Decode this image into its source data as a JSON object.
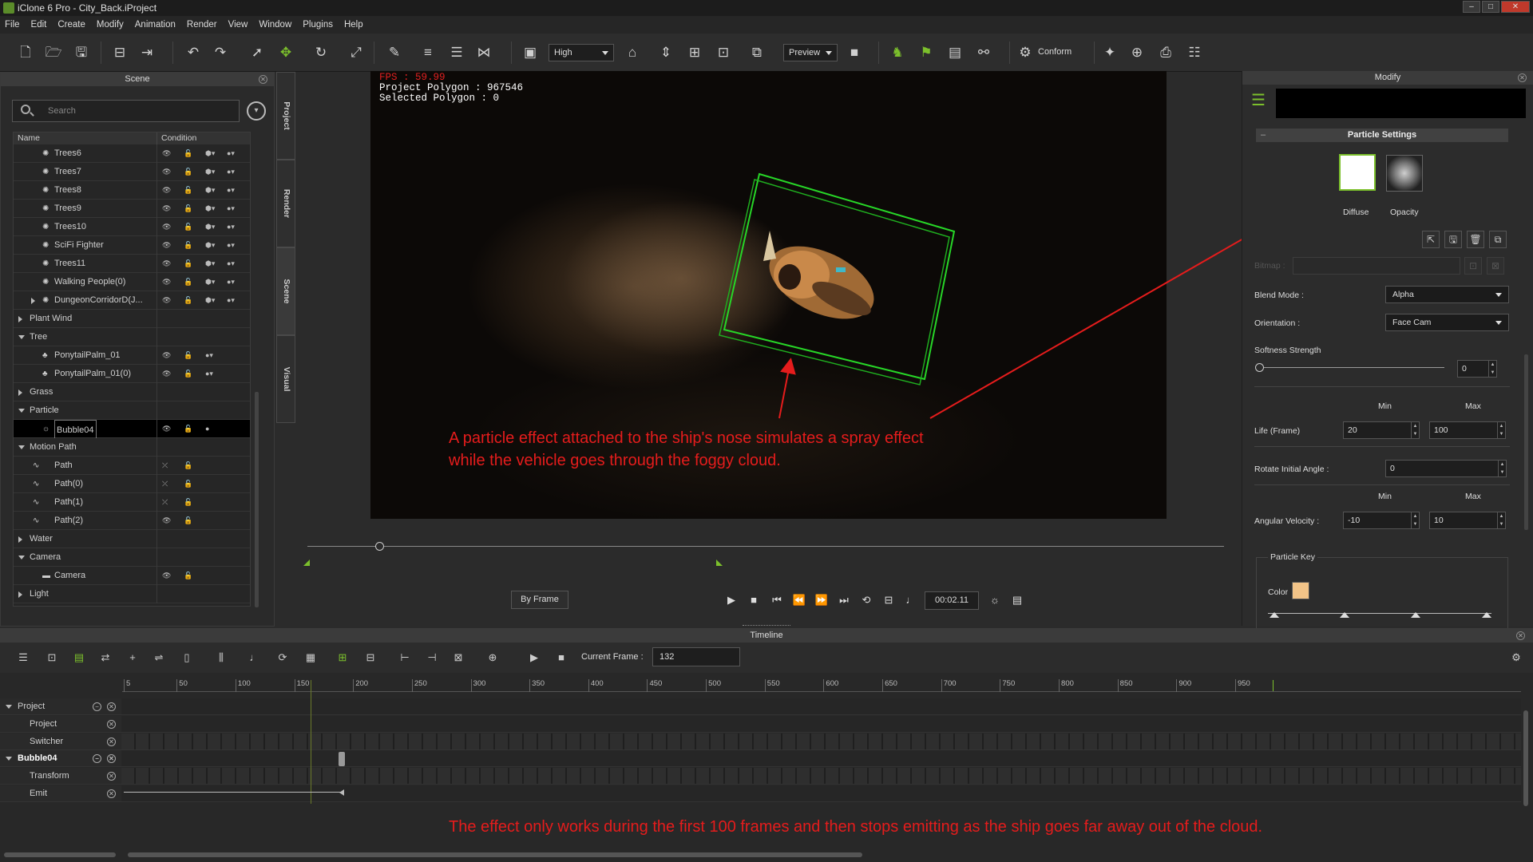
{
  "window": {
    "title": "iClone 6 Pro - City_Back.iProject"
  },
  "menu": [
    "File",
    "Edit",
    "Create",
    "Modify",
    "Animation",
    "Render",
    "View",
    "Window",
    "Plugins",
    "Help"
  ],
  "toolbar": {
    "quality": "High",
    "preview": "Preview",
    "conform": "Conform"
  },
  "scene": {
    "title": "Scene",
    "search_placeholder": "Search",
    "col_name": "Name",
    "col_condition": "Condition",
    "rows": [
      {
        "label": "Trees6",
        "level": 2,
        "icon": "gear",
        "cond": "full"
      },
      {
        "label": "Trees7",
        "level": 2,
        "icon": "gear",
        "cond": "full"
      },
      {
        "label": "Trees8",
        "level": 2,
        "icon": "gear",
        "cond": "full"
      },
      {
        "label": "Trees9",
        "level": 2,
        "icon": "gear",
        "cond": "full"
      },
      {
        "label": "Trees10",
        "level": 2,
        "icon": "gear",
        "cond": "full"
      },
      {
        "label": "SciFi Fighter",
        "level": 2,
        "icon": "gear",
        "cond": "full"
      },
      {
        "label": "Trees11",
        "level": 2,
        "icon": "gear",
        "cond": "full"
      },
      {
        "label": "Walking People(0)",
        "level": 2,
        "icon": "gear",
        "cond": "full"
      },
      {
        "label": "DungeonCorridorD(J...",
        "level": 2,
        "icon": "gear",
        "cond": "full",
        "exp": "r"
      },
      {
        "label": "Plant Wind",
        "level": 0,
        "exp": "r",
        "cond": "none"
      },
      {
        "label": "Tree",
        "level": 0,
        "exp": "d",
        "cond": "none"
      },
      {
        "label": "PonytailPalm_01",
        "level": 2,
        "icon": "palm",
        "cond": "tree"
      },
      {
        "label": "PonytailPalm_01(0)",
        "level": 2,
        "icon": "palm",
        "cond": "tree"
      },
      {
        "label": "Grass",
        "level": 0,
        "exp": "r",
        "cond": "none"
      },
      {
        "label": "Particle",
        "level": 0,
        "exp": "d",
        "cond": "none"
      },
      {
        "label": "Bubble04",
        "level": 2,
        "icon": "particle",
        "cond": "particle",
        "sel": true
      },
      {
        "label": "Motion Path",
        "level": 0,
        "exp": "d",
        "cond": "none"
      },
      {
        "label": "Path",
        "level": 1,
        "icon": "path",
        "cond": "path"
      },
      {
        "label": "Path(0)",
        "level": 1,
        "icon": "path",
        "cond": "path"
      },
      {
        "label": "Path(1)",
        "level": 1,
        "icon": "path",
        "cond": "path"
      },
      {
        "label": "Path(2)",
        "level": 1,
        "icon": "path",
        "cond": "eye"
      },
      {
        "label": "Water",
        "level": 0,
        "exp": "r",
        "cond": "none"
      },
      {
        "label": "Camera",
        "level": 0,
        "exp": "d",
        "cond": "none"
      },
      {
        "label": "Camera",
        "level": 2,
        "icon": "camera",
        "cond": "eye"
      },
      {
        "label": "Light",
        "level": 0,
        "exp": "r",
        "cond": "none"
      }
    ]
  },
  "side_tabs": [
    "Project",
    "Render",
    "Scene",
    "Visual"
  ],
  "viewport": {
    "fps": "FPS : 59.99",
    "project_polygon": "Project Polygon : 967546",
    "selected_polygon": "Selected Polygon : 0",
    "annotation1_line1": "A particle effect attached to the ship's nose simulates a spray effect",
    "annotation1_line2": "while the vehicle goes through the foggy cloud.",
    "annotation2": "The effect only works during the first 100 frames and then stops emitting as the ship goes far away out of the cloud.",
    "annotation_color": "#e51c1c"
  },
  "playback": {
    "by_frame": "By Frame",
    "timecode": "00:02.11"
  },
  "modify": {
    "title": "Modify",
    "section": "Particle Settings",
    "diffuse": "Diffuse",
    "opacity": "Opacity",
    "bitmap": "Bitmap :",
    "blend_mode_label": "Blend Mode :",
    "blend_mode": "Alpha",
    "orientation_label": "Orientation :",
    "orientation": "Face Cam",
    "softness_label": "Softness Strength",
    "softness": "0",
    "min": "Min",
    "max": "Max",
    "life_label": "Life (Frame)",
    "life_min": "20",
    "life_max": "100",
    "rotate_label": "Rotate Initial Angle :",
    "rotate": "0",
    "angvel_label": "Angular Velocity :",
    "angvel_min": "-10",
    "angvel_max": "10",
    "particle_key": "Particle Key",
    "color_label": "Color",
    "color_swatch": "#f3c488"
  },
  "timeline": {
    "title": "Timeline",
    "current_frame_label": "Current Frame :",
    "current_frame": "132",
    "ruler": [
      "5",
      "50",
      "100",
      "150",
      "200",
      "250",
      "300",
      "350",
      "400",
      "450",
      "500",
      "550",
      "600",
      "650",
      "700",
      "750",
      "800",
      "850",
      "900",
      "950"
    ],
    "tracks": [
      {
        "label": "Project",
        "level": 0,
        "bold": false,
        "exp": true
      },
      {
        "label": "Project",
        "level": 1
      },
      {
        "label": "Switcher",
        "level": 1
      },
      {
        "label": "Bubble04",
        "level": 0,
        "bold": true,
        "exp": true
      },
      {
        "label": "Transform",
        "level": 1
      },
      {
        "label": "Emit",
        "level": 1
      }
    ]
  }
}
